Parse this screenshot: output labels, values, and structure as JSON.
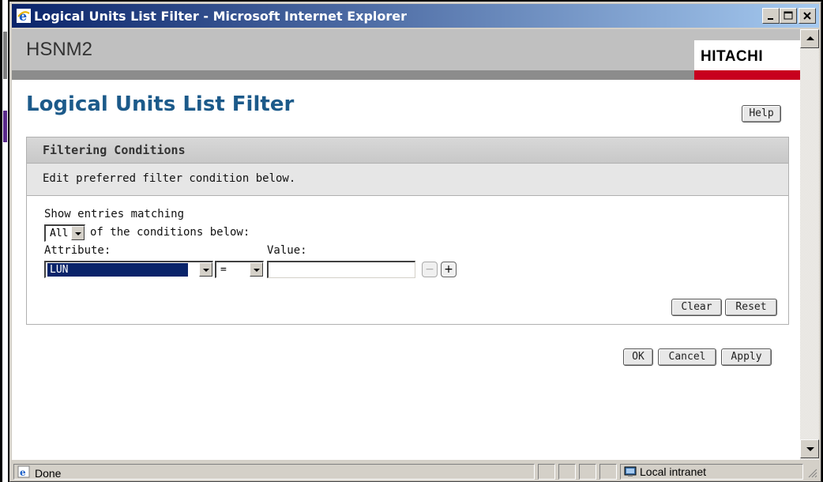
{
  "window": {
    "title": "Logical Units List Filter - Microsoft Internet Explorer",
    "controls": {
      "minimize": "minimize",
      "maximize": "maximize",
      "close": "close"
    }
  },
  "banner": {
    "app_name": "HSNM2",
    "logo": "HITACHI"
  },
  "page": {
    "title": "Logical Units List Filter",
    "help_label": "Help"
  },
  "panel": {
    "header": "Filtering Conditions",
    "instruction": "Edit preferred filter condition below.",
    "show_entries_label": "Show entries matching",
    "match_mode": "All",
    "conditions_suffix": "of the conditions below:",
    "attribute_label": "Attribute:",
    "value_label": "Value:",
    "condition": {
      "attribute": "LUN",
      "operator": "=",
      "value": ""
    },
    "remove_label": "−",
    "add_label": "+",
    "clear_label": "Clear",
    "reset_label": "Reset"
  },
  "actions": {
    "ok_label": "OK",
    "cancel_label": "Cancel",
    "apply_label": "Apply"
  },
  "status": {
    "text": "Done",
    "zone": "Local intranet"
  },
  "colors": {
    "title_color": "#1c5a8a",
    "logo_red": "#c8001e",
    "titlebar": "#0a246a"
  }
}
